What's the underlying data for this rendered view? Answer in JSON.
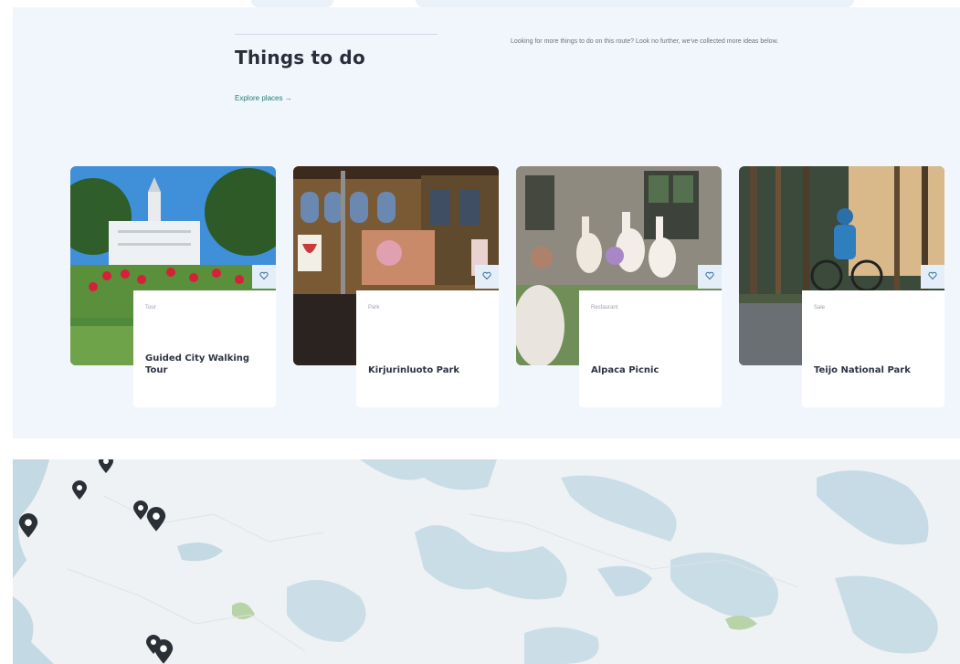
{
  "section": {
    "title": "Things to do",
    "explore_link": "Explore places →",
    "intro": "Looking for more things to do on this route? Look no further, we've collected more ideas below."
  },
  "cards": [
    {
      "category": "Tour",
      "name": "Guided City Walking Tour",
      "favorite_icon": "heart-icon"
    },
    {
      "category": "Park",
      "name": "Kirjurinluoto Park",
      "favorite_icon": "heart-icon"
    },
    {
      "category": "Restaurant",
      "name": "Alpaca Picnic",
      "favorite_icon": "heart-icon"
    },
    {
      "category": "Sale",
      "name": "Teijo National Park",
      "favorite_icon": "heart-icon"
    }
  ],
  "map": {
    "marker_icon": "map-pin-icon"
  },
  "colors": {
    "accent": "#1f7d72",
    "section_bg": "#f1f6fc",
    "heading": "#2a2e3a",
    "water": "#c3d9e4",
    "land": "#eef2f5",
    "marker": "#2b2f36"
  }
}
